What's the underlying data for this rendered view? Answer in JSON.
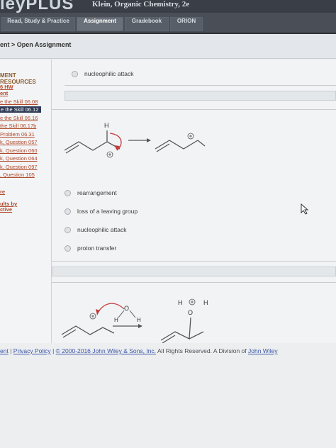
{
  "header": {
    "brand": "leyPLUS",
    "book_title": "Klein, Organic Chemistry, 2e",
    "tabs": [
      {
        "label": "Read, Study & Practice",
        "active": false
      },
      {
        "label": "Assignment",
        "active": true
      },
      {
        "label": "Gradebook",
        "active": false
      },
      {
        "label": "ORION",
        "active": false
      }
    ]
  },
  "breadcrumb": {
    "text": "ent > Open Assignment"
  },
  "sidebar": {
    "heading": "MENT RESOURCES",
    "items": [
      "6 HW",
      "ent",
      "e the Skill 06.08",
      "e the Skill 06.12",
      "e the Skill 06.16",
      "the Skill 06.17b",
      "Problem 06.31",
      "k, Question 057",
      "k, Question 060",
      "k, Question 064",
      "k, Question 097",
      ", Question 105",
      "re",
      "ults by",
      "ctive"
    ]
  },
  "question_top": {
    "option": "nucleophilic attack"
  },
  "question_main": {
    "options": [
      "rearrangement",
      "loss of a leaving group",
      "nucleophilic attack",
      "proton transfer"
    ],
    "reaction_labels": {
      "h_label": "H",
      "plus": "⊕"
    }
  },
  "question_bottom": {
    "labels": {
      "h1": "H",
      "h2": "H",
      "h3": "H",
      "h4": "H",
      "o": "O",
      "plus": "⊕"
    }
  },
  "footer": {
    "links": [
      "ent",
      "Privacy Policy"
    ],
    "copyright_link": "© 2000-2016 John Wiley & Sons, Inc.",
    "rights_text": "All Rights Reserved. A Division of",
    "division_link": "John Wiley"
  }
}
